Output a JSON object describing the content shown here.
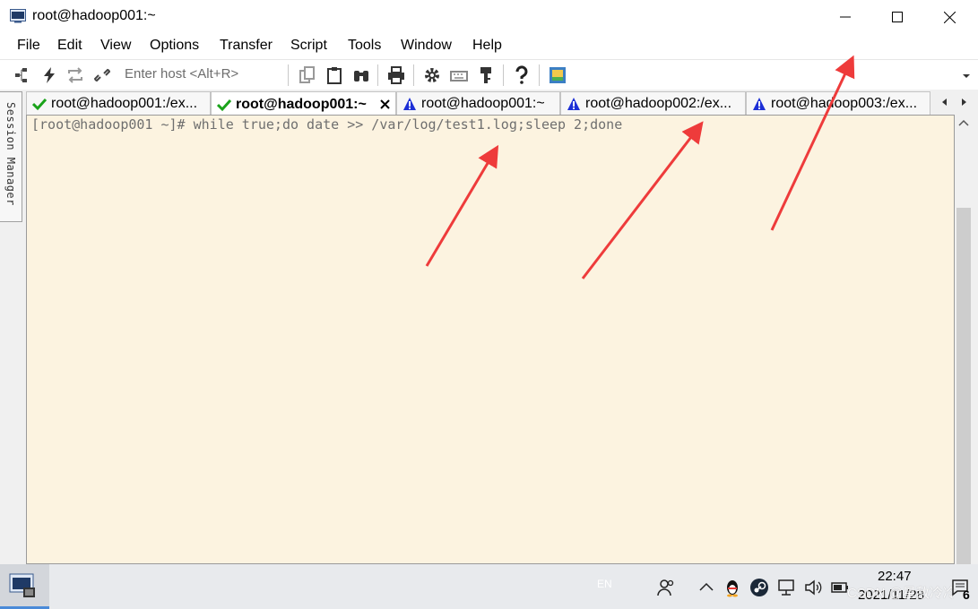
{
  "window": {
    "title": "root@hadoop001:~"
  },
  "menu": [
    "File",
    "Edit",
    "View",
    "Options",
    "Transfer",
    "Script",
    "Tools",
    "Window",
    "Help"
  ],
  "toolbar": {
    "host_placeholder": "Enter host <Alt+R>"
  },
  "session_manager": {
    "label": "Session Manager"
  },
  "tabs": [
    {
      "label": "root@hadoop001:/ex...",
      "status": "connected"
    },
    {
      "label": "root@hadoop001:~",
      "status": "connected",
      "active": true
    },
    {
      "label": "root@hadoop001:~",
      "status": "warning"
    },
    {
      "label": "root@hadoop002:/ex...",
      "status": "warning"
    },
    {
      "label": "root@hadoop003:/ex...",
      "status": "warning"
    }
  ],
  "terminal": {
    "line": "[root@hadoop001 ~]# while true;do date >> /var/log/test1.log;sleep 2;done"
  },
  "taskbar": {
    "lang": "EN",
    "time": "22:47",
    "date": "2021/11/28",
    "watermark": "CSDN @星敌冷冷",
    "notification_count": "6"
  },
  "colors": {
    "terminal_bg": "#fcf3e0",
    "arrow": "#ee3b3b",
    "ok": "#1aa31a",
    "warn": "#1c2fd6"
  }
}
